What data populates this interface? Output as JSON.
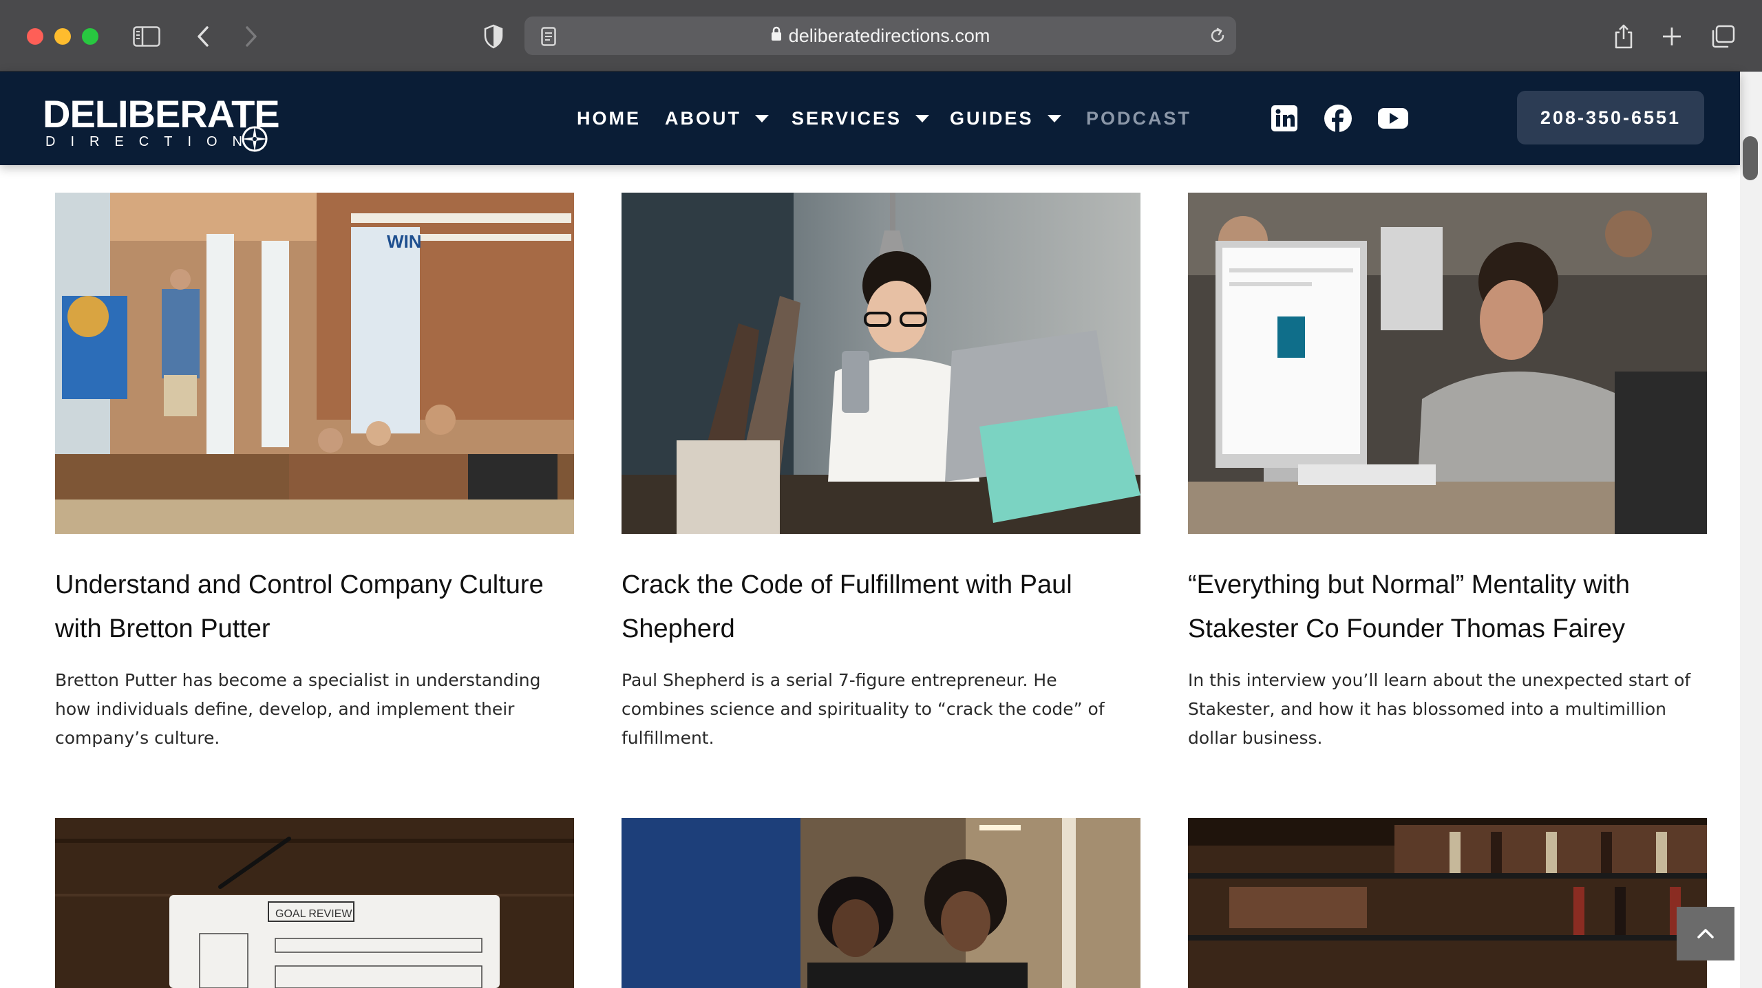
{
  "browser": {
    "url": "deliberatedirections.com"
  },
  "header": {
    "logo_top": "DELIBERATE",
    "logo_bottom": "DIRECTIONS",
    "nav": {
      "home": "HOME",
      "about": "ABOUT",
      "services": "SERVICES",
      "guides": "GUIDES",
      "podcast": "PODCAST"
    },
    "social": [
      "linkedin-icon",
      "facebook-icon",
      "youtube-icon"
    ],
    "phone": "208-350-6551"
  },
  "colors": {
    "header_bg": "#0a1d36",
    "phone_button": "#2c3c54",
    "nav_active_muted": "#8b97a8"
  },
  "posts": [
    {
      "title": "Understand and Control Company Culture with Bretton Putter",
      "excerpt": "Bretton Putter has become a specialist in understanding how individuals define, develop, and implement their company’s culture."
    },
    {
      "title": "Crack the Code of Fulfillment with Paul Shepherd",
      "excerpt": "Paul Shepherd is a serial 7-figure entrepreneur. He combines science and spirituality to “crack the code” of fulfillment."
    },
    {
      "title": "“Everything but Normal” Mentality with Stakester Co Founder Thomas Fairey",
      "excerpt": "In this interview you’ll learn about the unexpected start of Stakester, and how it has blossomed into a multimillion dollar business."
    }
  ],
  "photo_texts": {
    "win_sign": "WIN",
    "goal_review": "GOAL REVIEW"
  }
}
